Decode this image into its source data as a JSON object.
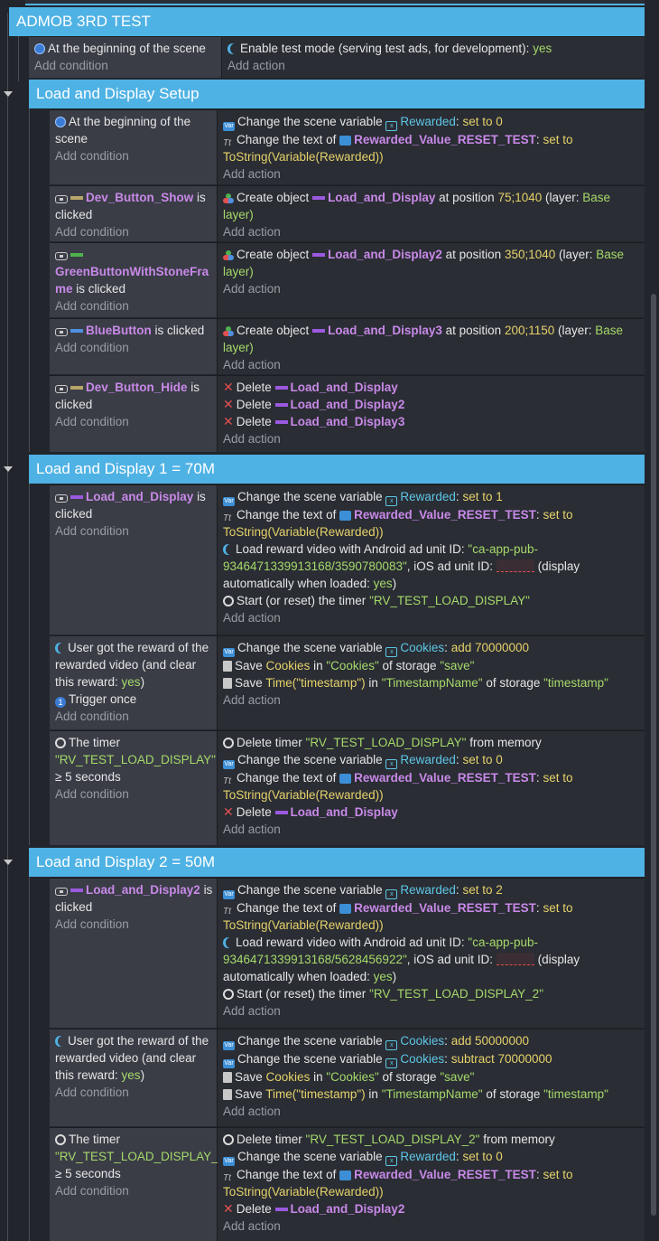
{
  "groups": {
    "g1": "ADMOB 3RD TEST",
    "g2": "Load and Display Setup",
    "g3": "Load and Display 1 = 70M",
    "g4": "Load and Display 2 = 50M"
  },
  "common": {
    "add_condition": "Add condition",
    "add_action": "Add action",
    "is_clicked": "is clicked",
    "at_beginning": "At the beginning of the scene",
    "change_scene_variable": "Change the scene variable",
    "change_text_of": "Change the text of",
    "set_to": "set to",
    "tostring": "ToString(Variable(Rewarded))",
    "create_object": "Create object",
    "at_position": "at position",
    "layer_prefix": "(layer:",
    "layer_base": "Base",
    "layer_suffix": "layer)",
    "delete": "Delete",
    "user_got_reward": "User got the reward of the rewarded video (and clear this reward:",
    "yes": "yes",
    "close_paren": ")",
    "trigger_once": "Trigger once",
    "the_timer": "The timer",
    "gte_5": "≥ 5 seconds",
    "save": "Save",
    "in": "in",
    "of_storage": "of storage",
    "add": "add",
    "subtract": "subtract",
    "from_memory": "from memory",
    "delete_timer": "Delete timer",
    "start_timer": "Start (or reset) the timer",
    "load_reward_video": "Load reward video with Android ad unit ID:",
    "ios_ad_unit": ", iOS ad unit ID:",
    "display_auto": "(display automatically when loaded:",
    "colon": ":"
  },
  "names": {
    "rewarded": "Rewarded",
    "cookies": "Cookies",
    "rewarded_text": "Rewarded_Value_RESET_TEST",
    "dev_show": "Dev_Button_Show",
    "green_btn": "GreenButtonWithStoneFrame",
    "blue_btn": "BlueButton",
    "dev_hide": "Dev_Button_Hide",
    "lad": "Load_and_Display",
    "lad2": "Load_and_Display2",
    "lad3": "Load_and_Display3",
    "cookies_key": "\"Cookies\"",
    "save_key": "\"save\"",
    "time_ts": "Time(\"timestamp\")",
    "ts_name": "\"TimestampName\"",
    "ts_key": "\"timestamp\"",
    "timer1": "\"RV_TEST_LOAD_DISPLAY\"",
    "timer2": "\"RV_TEST_LOAD_DISPLAY_2\"",
    "ad1": "\"ca-app-pub-9346471339913168/3590780083\"",
    "ad2": "\"ca-app-pub-9346471339913168/5628456922\""
  },
  "events": {
    "e0_act": "Enable test mode (serving test ads, for development):",
    "v0": "0",
    "v1": "1",
    "v2": "2",
    "pos1": "75;1040",
    "pos2": "350;1040",
    "pos3": "200;1150",
    "amt70": "70000000",
    "amt50": "50000000"
  }
}
